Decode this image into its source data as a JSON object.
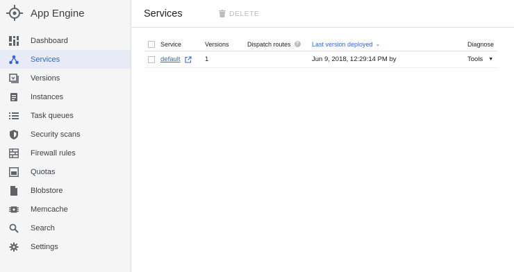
{
  "app": {
    "title": "App Engine"
  },
  "sidebar": {
    "items": [
      {
        "label": "Dashboard",
        "icon": "dashboard-icon"
      },
      {
        "label": "Services",
        "icon": "services-icon",
        "active": true
      },
      {
        "label": "Versions",
        "icon": "versions-icon"
      },
      {
        "label": "Instances",
        "icon": "instances-icon"
      },
      {
        "label": "Task queues",
        "icon": "task-queues-icon"
      },
      {
        "label": "Security scans",
        "icon": "shield-icon"
      },
      {
        "label": "Firewall rules",
        "icon": "firewall-icon"
      },
      {
        "label": "Quotas",
        "icon": "quotas-icon"
      },
      {
        "label": "Blobstore",
        "icon": "file-icon"
      },
      {
        "label": "Memcache",
        "icon": "chip-icon"
      },
      {
        "label": "Search",
        "icon": "search-icon"
      },
      {
        "label": "Settings",
        "icon": "gear-icon"
      }
    ]
  },
  "header": {
    "title": "Services",
    "delete_label": "DELETE"
  },
  "table": {
    "columns": {
      "service": "Service",
      "versions": "Versions",
      "dispatch": "Dispatch routes",
      "help": "?",
      "deployed": "Last version deployed",
      "diagnose": "Diagnose"
    },
    "rows": [
      {
        "service": "default",
        "versions": "1",
        "deployed": "Jun 9, 2018, 12:29:14 PM by",
        "diagnose": "Tools"
      }
    ]
  },
  "colors": {
    "accent": "#3367d6",
    "sidebar_bg": "#f5f5f5",
    "active_bg": "#e8eaf6"
  }
}
